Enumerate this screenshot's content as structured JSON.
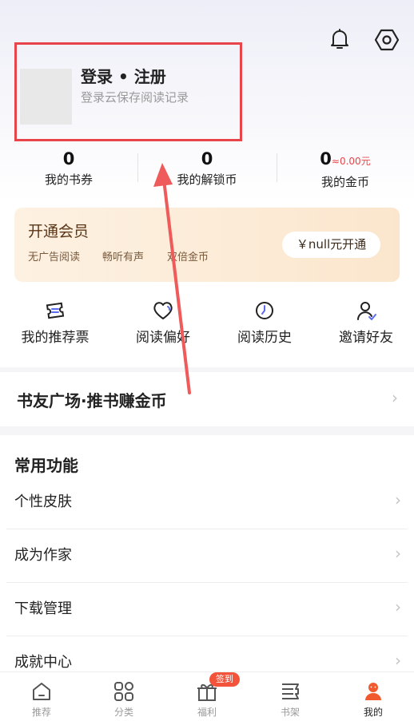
{
  "header": {
    "bell_icon": "bell-icon",
    "settings_icon": "hexagon-settings-icon"
  },
  "profile": {
    "title": "登录 • 注册",
    "subtitle": "登录云保存阅读记录"
  },
  "stats": [
    {
      "value": "0",
      "label": "我的书券"
    },
    {
      "value": "0",
      "label": "我的解锁币"
    },
    {
      "value": "0",
      "extra": "≈0.00元",
      "label": "我的金币"
    }
  ],
  "vip": {
    "title": "开通会员",
    "features": [
      "无广告阅读",
      "畅听有声",
      "双倍金币"
    ],
    "button": "￥null元开通"
  },
  "quick_actions": [
    {
      "label": "我的推荐票",
      "icon": "ticket-icon"
    },
    {
      "label": "阅读偏好",
      "icon": "heart-icon"
    },
    {
      "label": "阅读历史",
      "icon": "clock-icon"
    },
    {
      "label": "邀请好友",
      "icon": "invite-user-icon"
    }
  ],
  "square": {
    "title": "书友广场·推书赚金币"
  },
  "common": {
    "title": "常用功能",
    "items": [
      "个性皮肤",
      "成为作家",
      "下载管理",
      "成就中心"
    ]
  },
  "tabbar": {
    "items": [
      {
        "label": "推荐",
        "icon": "home-icon"
      },
      {
        "label": "分类",
        "icon": "grid-icon"
      },
      {
        "label": "福利",
        "icon": "gift-icon"
      },
      {
        "label": "书架",
        "icon": "bookshelf-icon"
      },
      {
        "label": "我的",
        "icon": "user-icon"
      }
    ],
    "badge": "签到",
    "active": "我的"
  },
  "colors": {
    "accent_red": "#e8454a",
    "vip_bg": "#fcebd6",
    "badge": "#f2533a"
  }
}
